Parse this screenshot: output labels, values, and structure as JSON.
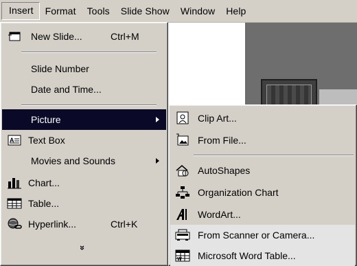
{
  "menubar": {
    "items": [
      {
        "label": "Insert",
        "active": true
      },
      {
        "label": "Format"
      },
      {
        "label": "Tools"
      },
      {
        "label": "Slide Show"
      },
      {
        "label": "Window"
      },
      {
        "label": "Help"
      }
    ]
  },
  "insert_menu": {
    "items": [
      {
        "label": "New Slide...",
        "shortcut": "Ctrl+M",
        "icon": "new-slide-icon"
      },
      {
        "label": "Slide Number"
      },
      {
        "label": "Date and Time..."
      },
      {
        "label": "Picture",
        "submenu": true,
        "highlighted": true
      },
      {
        "label": "Text Box",
        "icon": "text-box-icon"
      },
      {
        "label": "Movies and Sounds",
        "submenu": true
      },
      {
        "label": "Chart...",
        "icon": "chart-icon"
      },
      {
        "label": "Table...",
        "icon": "table-icon"
      },
      {
        "label": "Hyperlink...",
        "shortcut": "Ctrl+K",
        "icon": "hyperlink-icon"
      }
    ],
    "expand_glyph": "»"
  },
  "picture_submenu": {
    "items": [
      {
        "label": "Clip Art...",
        "icon": "clip-art-icon"
      },
      {
        "label": "From File...",
        "icon": "from-file-icon"
      },
      {
        "label": "AutoShapes",
        "icon": "autoshapes-icon"
      },
      {
        "label": "Organization Chart",
        "icon": "org-chart-icon"
      },
      {
        "label": "WordArt...",
        "icon": "wordart-icon"
      },
      {
        "label": "From Scanner or Camera...",
        "icon": "scanner-icon"
      },
      {
        "label": "Microsoft Word Table...",
        "icon": "word-table-icon"
      }
    ]
  },
  "colors": {
    "menu_bg": "#d4d0c8",
    "highlight_bg": "#0a0a28",
    "highlight_text": "#ffffff"
  }
}
